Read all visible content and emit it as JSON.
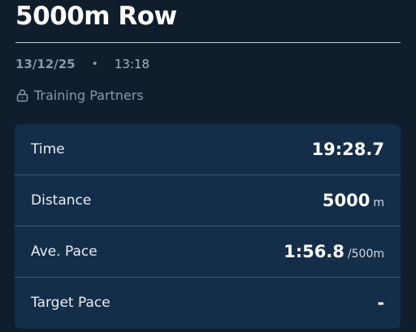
{
  "workout": {
    "title": "5000m Row",
    "date": "13/12/25",
    "separator": "•",
    "time": "13:18",
    "partners_label": "Training Partners",
    "partners_icon": "lock-icon"
  },
  "stats": [
    {
      "label": "Time",
      "value": "19:28.7",
      "unit": ""
    },
    {
      "label": "Distance",
      "value": "5000",
      "unit": "m"
    },
    {
      "label": "Ave. Pace",
      "value": "1:56.8",
      "unit": "/500m"
    },
    {
      "label": "Target Pace",
      "value": "-",
      "unit": ""
    }
  ],
  "colors": {
    "background": "#0f1d2c",
    "card": "#142d48",
    "muted_text": "#8898ab"
  }
}
